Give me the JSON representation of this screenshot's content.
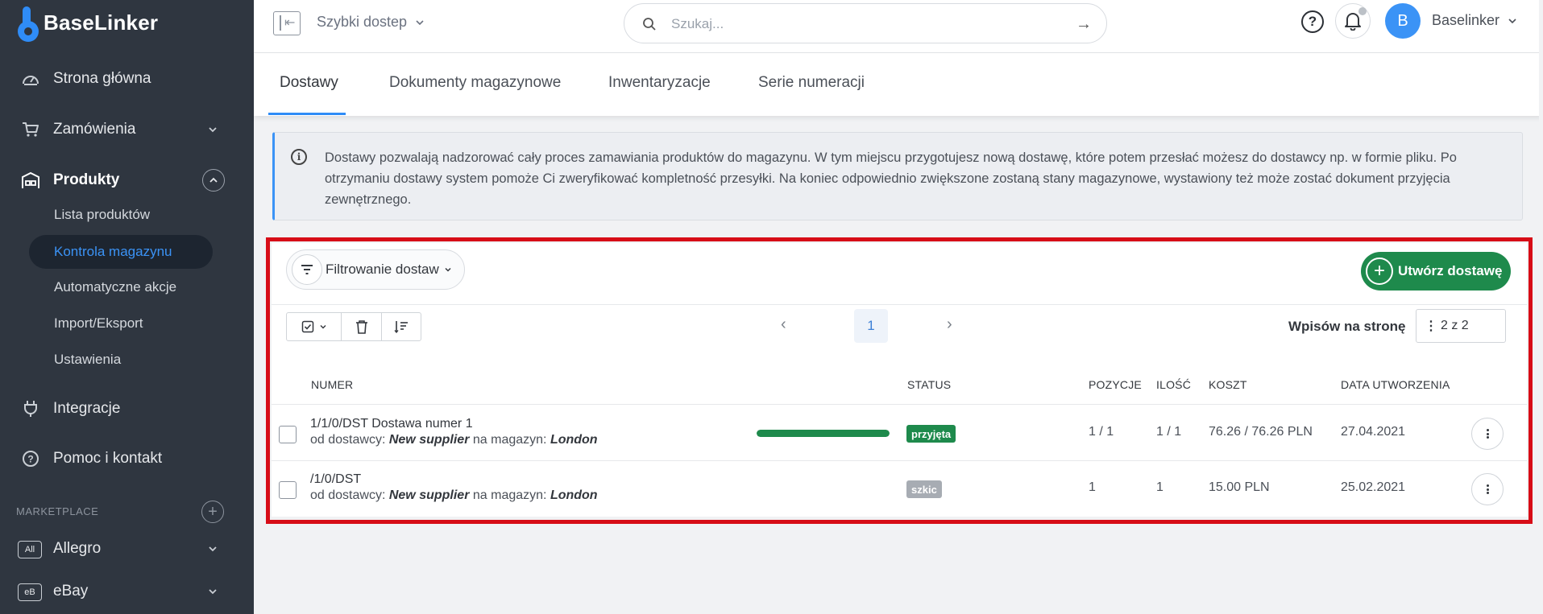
{
  "app": {
    "name": "BaseLinker"
  },
  "sidebar": {
    "items": [
      {
        "label": "Strona główna",
        "icon": "dashboard-icon"
      },
      {
        "label": "Zamówienia",
        "icon": "cart-icon"
      },
      {
        "label": "Produkty",
        "icon": "warehouse-icon"
      },
      {
        "label": "Integracje",
        "icon": "plug-icon"
      },
      {
        "label": "Pomoc i kontakt",
        "icon": "help-circle-icon"
      }
    ],
    "sub_items": [
      {
        "label": "Lista produktów"
      },
      {
        "label": "Kontrola magazynu"
      },
      {
        "label": "Automatyczne akcje"
      },
      {
        "label": "Import/Eksport"
      },
      {
        "label": "Ustawienia"
      }
    ],
    "marketplace_label": "MARKETPLACE",
    "marketplaces": [
      {
        "badge": "All",
        "label": "Allegro"
      },
      {
        "badge": "eB",
        "label": "eBay"
      }
    ]
  },
  "header": {
    "quick_access": "Szybki dostep",
    "search_placeholder": "Szukaj...",
    "avatar_letter": "B",
    "user_name": "Baselinker"
  },
  "tabs": [
    {
      "label": "Dostawy"
    },
    {
      "label": "Dokumenty magazynowe"
    },
    {
      "label": "Inwentaryzacje"
    },
    {
      "label": "Serie numeracji"
    }
  ],
  "info": {
    "text": "Dostawy pozwalają nadzorować cały proces zamawiania produktów do magazynu. W tym miejscu przygotujesz nową dostawę, które potem przesłać możesz do dostawcy np. w formie pliku. Po otrzymaniu dostawy system pomoże Ci zweryfikować kompletność przesyłki. Na koniec odpowiednio zwiększone zostaną stany magazynowe, wystawiony też może zostać dokument przyjęcia zewnętrznego."
  },
  "toolbar": {
    "filter_label": "Filtrowanie dostaw",
    "create_label": "Utwórz dostawę",
    "current_page": "1",
    "per_page_label": "Wpisów na stronę",
    "per_page_value": "2 z 2"
  },
  "table": {
    "headers": {
      "numer": "NUMER",
      "status": "STATUS",
      "pozycje": "POZYCJE",
      "ilosc": "ILOŚĆ",
      "koszt": "KOSZT",
      "data": "DATA UTWORZENIA"
    },
    "from_prefix": "od dostawcy:",
    "to_prefix": "na magazyn:",
    "rows": [
      {
        "number": "1/1/0/DST",
        "name": "Dostawa numer 1",
        "supplier": "New supplier",
        "warehouse": "London",
        "progress": 1.0,
        "status": "przyjęta",
        "status_color": "#1e8a4c",
        "pozycje": "1 / 1",
        "ilosc": "1 / 1",
        "koszt": "76.26 / 76.26 PLN",
        "data": "27.04.2021"
      },
      {
        "number": "/1/0/DST",
        "name": "",
        "supplier": "New supplier",
        "warehouse": "London",
        "status": "szkic",
        "status_color": "#a7acb3",
        "pozycje": "1",
        "ilosc": "1",
        "koszt": "15.00 PLN",
        "data": "25.02.2021"
      }
    ]
  },
  "colors": {
    "sidebar_bg": "#2f3640",
    "accent": "#2f8cf7",
    "success": "#1e8a4c",
    "highlight_outline": "#d70d17"
  }
}
